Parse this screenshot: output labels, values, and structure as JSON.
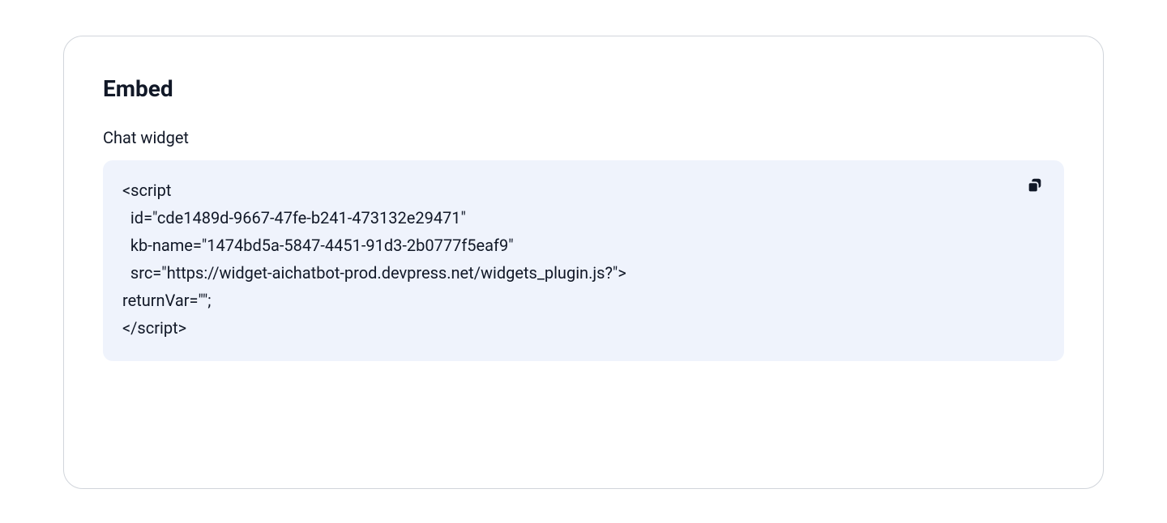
{
  "heading": "Embed",
  "subtitle": "Chat widget",
  "code": {
    "line1": "<script",
    "line2": "  id=\"cde1489d-9667-47fe-b241-473132e29471\"",
    "line3": "  kb-name=\"1474bd5a-5847-4451-91d3-2b0777f5eaf9\"",
    "line4": "  src=\"https://widget-aichatbot-prod.devpress.net/widgets_plugin.js?\">",
    "line5": "returnVar=\"\";",
    "line6": "</script>"
  }
}
